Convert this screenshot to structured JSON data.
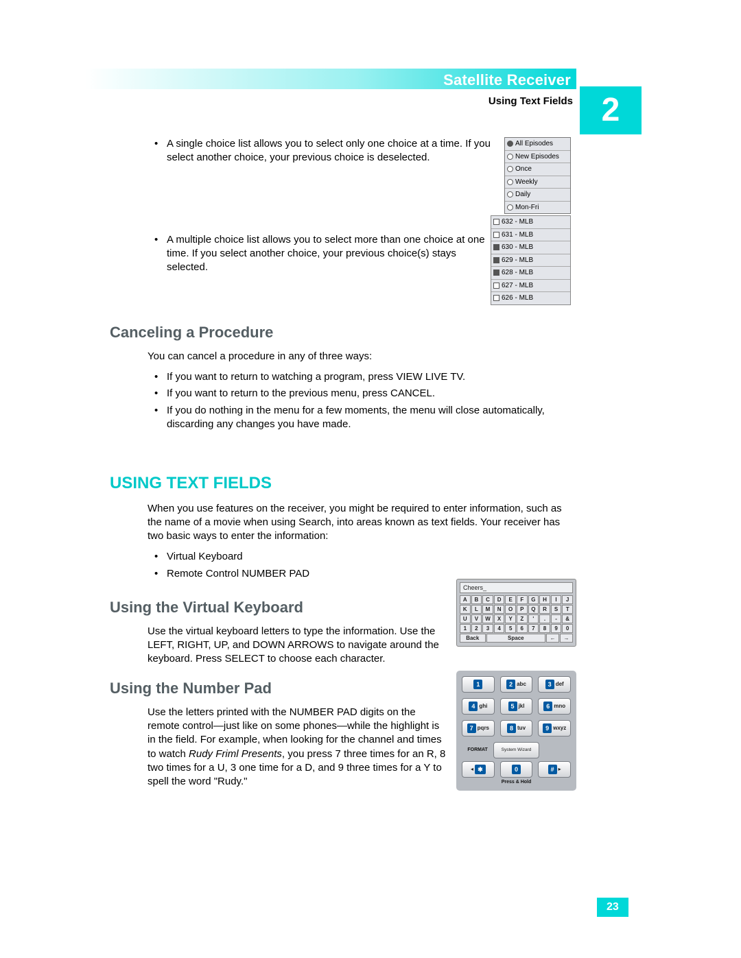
{
  "header": {
    "title": "Satellite Receiver",
    "subtitle": "Using Text Fields",
    "chapter": "2"
  },
  "bullets_top": {
    "b1": "A single choice list allows you to select only one choice at a time. If you select another choice, your previous choice is deselected.",
    "b2": "A multiple choice list allows you to select more than one choice at one time. If you select another choice, your previous choice(s) stays selected."
  },
  "single_choice_list": [
    "All Episodes",
    "New Episodes",
    "Once",
    "Weekly",
    "Daily",
    "Mon-Fri"
  ],
  "multi_choice_list": [
    "632 - MLB",
    "631 - MLB",
    "630 - MLB",
    "629 - MLB",
    "628 - MLB",
    "627 - MLB",
    "626 - MLB"
  ],
  "cancel": {
    "heading": "Canceling a Procedure",
    "intro": "You can cancel a procedure in any of three ways:",
    "items": [
      "If you want to return to watching a program, press VIEW LIVE TV.",
      "If you want to return to the previous menu, press CANCEL.",
      "If you do nothing in the menu for a few moments, the menu will close automatically, discarding any changes you have made."
    ]
  },
  "text_fields": {
    "heading": "USING TEXT FIELDS",
    "intro": "When you use features on the receiver, you might be required to enter information, such as the name of a movie when using Search, into areas known as text fields. Your receiver has two basic ways to enter the information:",
    "methods": [
      "Virtual Keyboard",
      "Remote Control NUMBER PAD"
    ]
  },
  "vkb": {
    "heading": "Using the Virtual Keyboard",
    "body": "Use the virtual keyboard letters to type the information. Use the LEFT, RIGHT, UP, and DOWN ARROWS to navigate around the keyboard. Press SELECT to choose each character.",
    "display": "Cheers_",
    "rows": [
      [
        "A",
        "B",
        "C",
        "D",
        "E",
        "F",
        "G",
        "H",
        "I",
        "J"
      ],
      [
        "K",
        "L",
        "M",
        "N",
        "O",
        "P",
        "Q",
        "R",
        "S",
        "T"
      ],
      [
        "U",
        "V",
        "W",
        "X",
        "Y",
        "Z",
        "'",
        ".",
        "-",
        "&"
      ],
      [
        "1",
        "2",
        "3",
        "4",
        "5",
        "6",
        "7",
        "8",
        "9",
        "0"
      ]
    ],
    "back": "Back",
    "space": "Space",
    "left": "←",
    "right": "→"
  },
  "numpad": {
    "heading": "Using the Number Pad",
    "body_pre": "Use the letters printed with the NUMBER PAD digits on the remote control—just like on some phones—while the highlight is in the field. For example, when looking for the channel and times to watch ",
    "body_ital": "Rudy Friml Presents",
    "body_post": ", you press 7 three times for an R, 8 two times for a U, 3 one time for a D, and 9 three times for a Y to spell the word \"Rudy.\"",
    "keys": [
      {
        "n": "1",
        "l": ""
      },
      {
        "n": "2",
        "l": "abc"
      },
      {
        "n": "3",
        "l": "def"
      },
      {
        "n": "4",
        "l": "ghi"
      },
      {
        "n": "5",
        "l": "jkl"
      },
      {
        "n": "6",
        "l": "mno"
      },
      {
        "n": "7",
        "l": "pqrs"
      },
      {
        "n": "8",
        "l": "tuv"
      },
      {
        "n": "9",
        "l": "wxyz"
      }
    ],
    "format": "FORMAT",
    "zero": "0",
    "sys": "System Wizard",
    "star": "✱",
    "hash": "#",
    "press": "Press & Hold"
  },
  "page_number": "23"
}
